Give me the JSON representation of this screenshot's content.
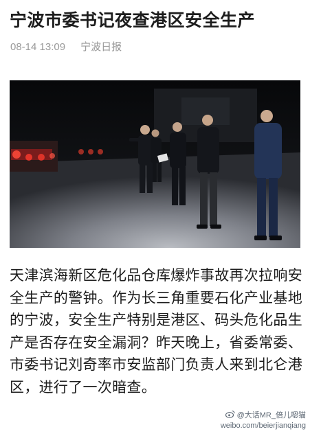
{
  "article": {
    "title": "宁波市委书记夜查港区安全生产",
    "date": "08-14 13:09",
    "source": "宁波日报",
    "photo": {
      "icon": "news-photo-night-inspection"
    },
    "body": "天津滨海新区危化品仓库爆炸事故再次拉响安全生产的警钟。作为长三角重要石化产业基地的宁波，安全生产特别是港区、码头危化品生产是否存在安全漏洞？昨天晚上，省委常委、市委书记刘奇率市安监部门负责人来到北仑港区，进行了一次暗查。"
  },
  "watermark": {
    "icon": "weibo-logo-icon",
    "handle": "@大话MR_倍儿嗯猫",
    "url": "weibo.com/beierjianqiang"
  }
}
